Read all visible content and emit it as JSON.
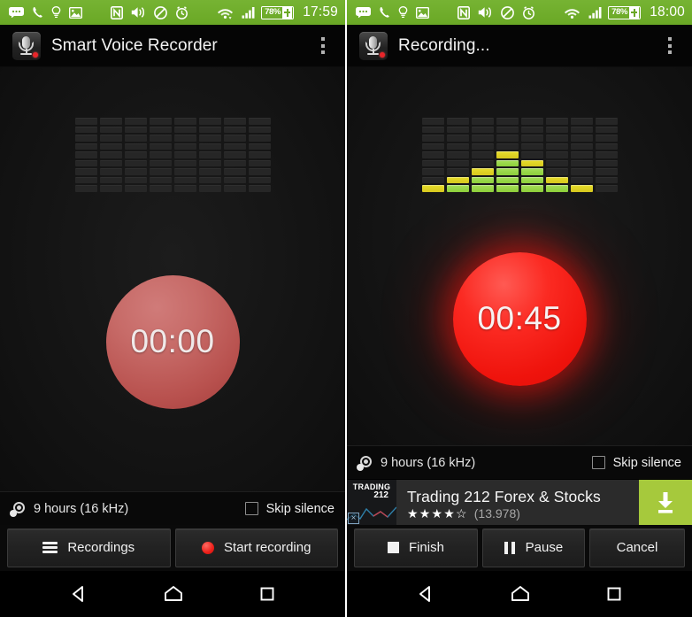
{
  "meta": {
    "panel_count": 2,
    "accent_green": "#6aa825",
    "ad_cta_green": "#a6c93c",
    "record_red_active": "#ef130c",
    "record_red_idle": "#b8514e",
    "eq_green": "#8ccf3a",
    "eq_yellow": "#d6c71e"
  },
  "panels": [
    {
      "id": "idle-panel",
      "statusbar": {
        "icons_left": [
          "sms-icon",
          "phone-call-icon",
          "lightbulb-icon",
          "image-icon",
          "nfc-icon",
          "volume-on-icon",
          "do-not-disturb-icon",
          "alarm-clock-icon",
          "wifi-icon",
          "cellular-signal-icon"
        ],
        "battery_pct": "78%",
        "battery_state": "charging",
        "clock": "17:59"
      },
      "actionbar": {
        "app_icon": "microphone-record-icon",
        "title": "Smart Voice Recorder",
        "overflow": "overflow-menu-icon"
      },
      "visualizer": {
        "columns": 8,
        "segments_per_column": 9,
        "levels": [
          0,
          0,
          0,
          0,
          0,
          0,
          0,
          0
        ]
      },
      "timer": {
        "value": "00:00",
        "state": "idle"
      },
      "infostrip": {
        "icon": "disc-quality-icon",
        "capacity": "9 hours (16 kHz)",
        "skip_silence_label": "Skip silence",
        "skip_silence_checked": false
      },
      "ad": null,
      "buttons": [
        {
          "icon": "hamburger-menu-icon",
          "label": "Recordings"
        },
        {
          "icon": "record-dot-icon",
          "label": "Start recording"
        }
      ],
      "navbar": [
        "back-icon",
        "home-icon",
        "recents-icon"
      ]
    },
    {
      "id": "recording-panel",
      "statusbar": {
        "icons_left": [
          "sms-icon",
          "phone-call-icon",
          "lightbulb-icon",
          "image-icon",
          "nfc-icon",
          "volume-on-icon",
          "do-not-disturb-icon",
          "alarm-clock-icon",
          "wifi-icon",
          "cellular-signal-icon"
        ],
        "battery_pct": "78%",
        "battery_state": "charging",
        "clock": "18:00"
      },
      "actionbar": {
        "app_icon": "microphone-record-icon",
        "title": "Recording...",
        "overflow": "overflow-menu-icon"
      },
      "visualizer": {
        "columns": 8,
        "segments_per_column": 9,
        "levels": [
          1,
          2,
          3,
          5,
          4,
          2,
          1,
          0
        ]
      },
      "timer": {
        "value": "00:45",
        "state": "recording"
      },
      "infostrip": {
        "icon": "disc-quality-icon",
        "capacity": "9 hours (16 kHz)",
        "skip_silence_label": "Skip silence",
        "skip_silence_checked": false
      },
      "ad": {
        "logo_line1": "TRADING",
        "logo_line2": "212",
        "title": "Trading 212 Forex & Stocks",
        "stars": "★★★★☆",
        "rating_value": 4,
        "reviews": "(13.978)",
        "cta_icon": "download-icon",
        "close_icon": "ad-close-icon"
      },
      "buttons": [
        {
          "icon": "stop-square-icon",
          "label": "Finish"
        },
        {
          "icon": "pause-icon",
          "label": "Pause"
        },
        {
          "icon": "",
          "label": "Cancel"
        }
      ],
      "navbar": [
        "back-icon",
        "home-icon",
        "recents-icon"
      ]
    }
  ]
}
